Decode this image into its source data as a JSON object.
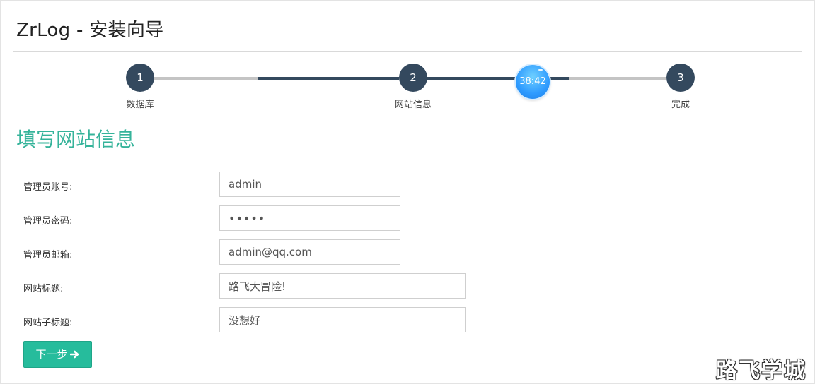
{
  "app_title": "ZrLog - 安装向导",
  "stepper": {
    "steps": [
      {
        "number": "1",
        "label": "数据库"
      },
      {
        "number": "2",
        "label": "网站信息"
      },
      {
        "number": "3",
        "label": "完成"
      }
    ],
    "current_step": 2,
    "timer_text": "38:42"
  },
  "section_title": "填写网站信息",
  "form": {
    "fields": [
      {
        "label": "管理员账号:",
        "value": "admin"
      },
      {
        "label": "管理员密码:",
        "value": "•••••"
      },
      {
        "label": "管理员邮箱:",
        "value": "admin@qq.com"
      },
      {
        "label": "网站标题:",
        "value": "路飞大冒险!"
      },
      {
        "label": "网站子标题:",
        "value": "没想好"
      }
    ],
    "next_button": "下一步",
    "next_icon": "arrow-right-icon"
  },
  "watermark": "路飞学城",
  "colors": {
    "step_dark": "#34495e",
    "accent_green": "#35b39a",
    "button_green": "#26bc9c",
    "timer_blue": "#2e9bff"
  }
}
